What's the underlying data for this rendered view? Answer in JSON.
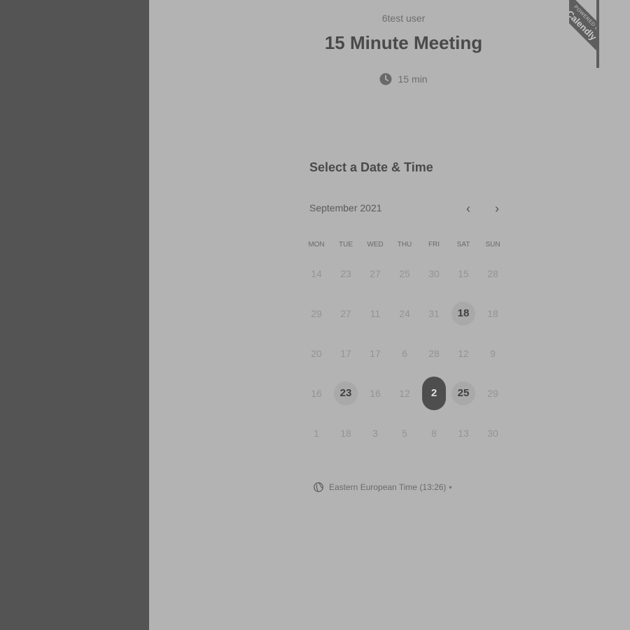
{
  "host_name": "6test user",
  "event_title": "15 Minute Meeting",
  "duration": {
    "icon": "clock-icon",
    "label": "15 min"
  },
  "ribbon": {
    "small": "POWERED BY",
    "big": "Calendly"
  },
  "calendar": {
    "section_title": "Select a Date & Time",
    "month": "September 2021",
    "prev_label": "‹",
    "next_label": "›",
    "weekdays": [
      "MON",
      "TUE",
      "WED",
      "THU",
      "FRI",
      "SAT",
      "SUN"
    ],
    "weeks": [
      [
        {
          "label": "14",
          "state": "disabled"
        },
        {
          "label": "23",
          "state": "disabled"
        },
        {
          "label": "27",
          "state": "disabled"
        },
        {
          "label": "25",
          "state": "disabled"
        },
        {
          "label": "30",
          "state": "disabled"
        },
        {
          "label": "15",
          "state": "disabled"
        },
        {
          "label": "28",
          "state": "disabled"
        }
      ],
      [
        {
          "label": "29",
          "state": "disabled"
        },
        {
          "label": "27",
          "state": "disabled"
        },
        {
          "label": "11",
          "state": "disabled"
        },
        {
          "label": "24",
          "state": "disabled"
        },
        {
          "label": "31",
          "state": "disabled"
        },
        {
          "label": "18",
          "state": "available"
        },
        {
          "label": "18",
          "state": "disabled"
        }
      ],
      [
        {
          "label": "20",
          "state": "disabled"
        },
        {
          "label": "17",
          "state": "disabled"
        },
        {
          "label": "17",
          "state": "disabled"
        },
        {
          "label": "6",
          "state": "disabled"
        },
        {
          "label": "28",
          "state": "disabled"
        },
        {
          "label": "12",
          "state": "disabled"
        },
        {
          "label": "9",
          "state": "disabled"
        }
      ],
      [
        {
          "label": "16",
          "state": "disabled"
        },
        {
          "label": "23",
          "state": "available"
        },
        {
          "label": "16",
          "state": "disabled"
        },
        {
          "label": "12",
          "state": "disabled"
        },
        {
          "label": "2",
          "state": "selected"
        },
        {
          "label": "25",
          "state": "available"
        },
        {
          "label": "29",
          "state": "disabled"
        }
      ],
      [
        {
          "label": "1",
          "state": "disabled"
        },
        {
          "label": "18",
          "state": "disabled"
        },
        {
          "label": "3",
          "state": "disabled"
        },
        {
          "label": "5",
          "state": "disabled"
        },
        {
          "label": "8",
          "state": "disabled"
        },
        {
          "label": "13",
          "state": "disabled"
        },
        {
          "label": "30",
          "state": "disabled"
        }
      ]
    ]
  },
  "timezone": {
    "icon": "globe-icon",
    "label": "Eastern European Time (13:26)",
    "caret": "▾"
  }
}
